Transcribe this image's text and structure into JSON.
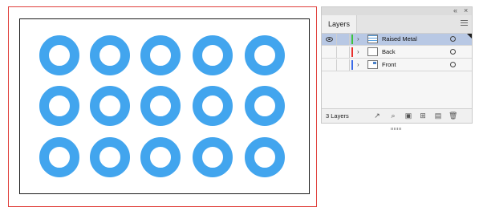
{
  "canvas": {
    "ring_color": "#42a5ee",
    "bleed_color": "#e0403c",
    "ring_rows": 3,
    "ring_columns": 5
  },
  "panel": {
    "collapse_icon": "double-chevron-right-icon",
    "close_icon": "close-icon",
    "collapse_glyph": "«",
    "close_glyph": "×",
    "tab_label": "Layers",
    "layers": [
      {
        "name": "Raised Metal",
        "color": "#3cc43c",
        "visible": true,
        "selected": true,
        "thumbnail": "pattern"
      },
      {
        "name": "Back",
        "color": "#e8302c",
        "visible": false,
        "selected": false,
        "thumbnail": "blank"
      },
      {
        "name": "Front",
        "color": "#3a6ae8",
        "visible": false,
        "selected": false,
        "thumbnail": "front"
      }
    ],
    "footer": {
      "layer_count": "3 Layers",
      "icons": [
        "export-icon",
        "search-icon",
        "clipping-mask-icon",
        "new-sublayer-icon",
        "new-layer-icon",
        "delete-icon"
      ]
    }
  }
}
